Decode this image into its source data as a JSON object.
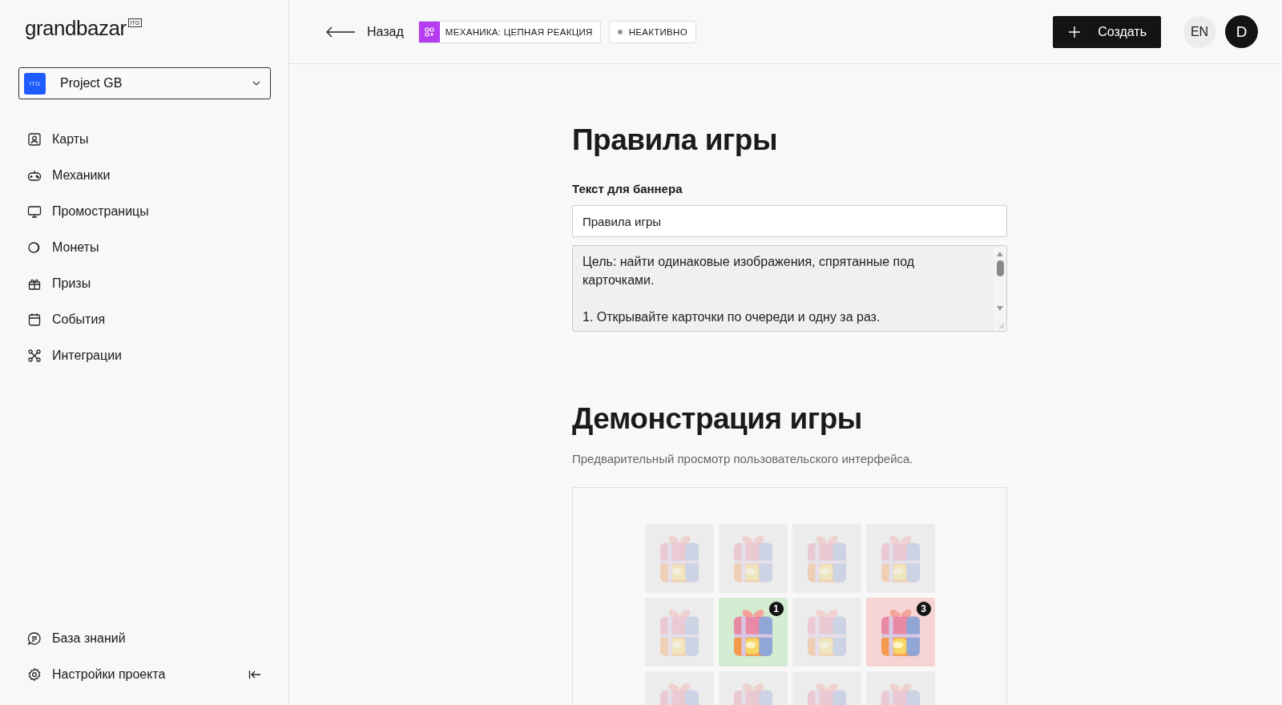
{
  "logo": {
    "name": "grandbazar",
    "badge": "ITG"
  },
  "project": {
    "name": "Project GB",
    "badge": "ITG"
  },
  "nav": [
    {
      "label": "Карты"
    },
    {
      "label": "Механики"
    },
    {
      "label": "Промостраницы"
    },
    {
      "label": "Монеты"
    },
    {
      "label": "Призы"
    },
    {
      "label": "События"
    },
    {
      "label": "Интеграции"
    }
  ],
  "nav_bottom": [
    {
      "label": "База знаний"
    },
    {
      "label": "Настройки проекта"
    }
  ],
  "header": {
    "back": "Назад",
    "mechanic_tag": "МЕХАНИКА: ЦЕПНАЯ РЕАКЦИЯ",
    "status": "НЕАКТИВНО",
    "create": "Создать",
    "lang": "EN",
    "avatar": "D"
  },
  "rules": {
    "title": "Правила игры",
    "label": "Текст для баннера",
    "banner_text": "Правила игры",
    "rules_text": "Цель: найти одинаковые изображения, спрятанные под карточками.\n\n1. Открывайте карточки по очереди и одну за раз."
  },
  "demo": {
    "title": "Демонстрация игры",
    "subtitle": "Предварительный просмотр пользовательского интерфейса.",
    "cards": [
      {
        "kind": "hidden"
      },
      {
        "kind": "hidden"
      },
      {
        "kind": "hidden"
      },
      {
        "kind": "hidden"
      },
      {
        "kind": "hidden"
      },
      {
        "kind": "match",
        "badge": "1"
      },
      {
        "kind": "hidden"
      },
      {
        "kind": "miss",
        "badge": "3"
      },
      {
        "kind": "hidden"
      },
      {
        "kind": "hidden"
      },
      {
        "kind": "hidden"
      },
      {
        "kind": "hidden"
      }
    ]
  }
}
